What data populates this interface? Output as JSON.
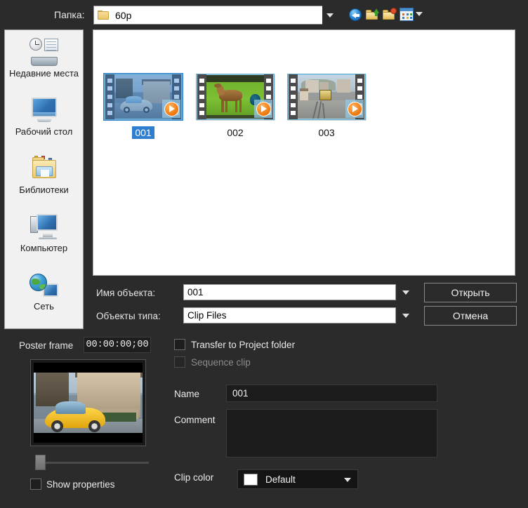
{
  "folder_bar": {
    "label": "Папка:",
    "value": "60p",
    "icons": [
      "back-icon",
      "up-folder-icon",
      "new-folder-icon",
      "views-icon"
    ]
  },
  "places": {
    "items": [
      {
        "label": "Недавние места",
        "icon": "recent-places-icon"
      },
      {
        "label": "Рабочий стол",
        "icon": "desktop-icon"
      },
      {
        "label": "Библиотеки",
        "icon": "libraries-icon"
      },
      {
        "label": "Компьютер",
        "icon": "computer-icon"
      },
      {
        "label": "Сеть",
        "icon": "network-icon"
      }
    ]
  },
  "file_list": {
    "items": [
      {
        "label": "001",
        "selected": true,
        "scene": "car"
      },
      {
        "label": "002",
        "selected": false,
        "scene": "antelope"
      },
      {
        "label": "003",
        "selected": false,
        "scene": "street"
      }
    ]
  },
  "name_row": {
    "label": "Имя объекта:",
    "value": "001"
  },
  "type_row": {
    "label": "Объекты типа:",
    "value": "Clip Files"
  },
  "buttons": {
    "open": "Открыть",
    "cancel": "Отмена"
  },
  "poster": {
    "label": "Poster frame",
    "timecode": "00:00:00;00",
    "show_properties_label": "Show properties",
    "show_properties_checked": false
  },
  "properties": {
    "transfer_label": "Transfer to Project folder",
    "transfer_checked": false,
    "sequence_label": "Sequence clip",
    "sequence_checked": false,
    "sequence_disabled": true,
    "name_label": "Name",
    "name_value": "001",
    "comment_label": "Comment",
    "comment_value": "",
    "clip_color_label": "Clip color",
    "clip_color_value": "Default",
    "clip_color_swatch": "#ffffff"
  },
  "colors": {
    "window_bg": "#2b2b2b",
    "panel_white": "#ffffff",
    "places_bg": "#f1f1f1",
    "selection_blue": "#2f7fd0",
    "play_orange": "#ef7a10",
    "text_light": "#eaeaea"
  }
}
